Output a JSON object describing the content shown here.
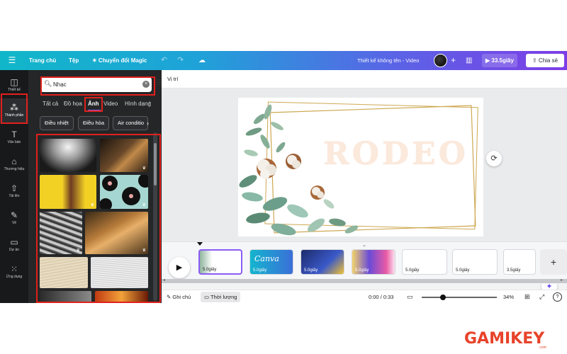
{
  "topbar": {
    "menu_icon": "hamburger-icon",
    "home": "Trang chủ",
    "file": "Tệp",
    "magic": "✶ Chuyển đổi Magic",
    "title": "Thiết kế không tên - Video",
    "plus": "+",
    "play_label": "▶ 33.5giây",
    "share_label": "Chia sẻ"
  },
  "rail": {
    "items": [
      {
        "label": "Thiết kế",
        "icon": "layout-icon"
      },
      {
        "label": "Thành phần",
        "icon": "shapes-icon"
      },
      {
        "label": "Văn bản",
        "icon": "text-icon"
      },
      {
        "label": "Thương hiệu",
        "icon": "brand-icon"
      },
      {
        "label": "Tải lên",
        "icon": "upload-icon"
      },
      {
        "label": "Vẽ",
        "icon": "draw-icon"
      },
      {
        "label": "Dự án",
        "icon": "folder-icon"
      },
      {
        "label": "Ứng dụng",
        "icon": "apps-icon"
      }
    ]
  },
  "panel": {
    "search_value": "Nhạc",
    "tabs": [
      "Tất cả",
      "Đồ họa",
      "Ảnh",
      "Video",
      "Hình dạng"
    ],
    "active_tab": "Ảnh",
    "chips": [
      "Điều nhiệt",
      "Điều hòa",
      "Air conditio"
    ]
  },
  "canvas": {
    "position_label": "Vị trí",
    "slide_text": "RODEO"
  },
  "timeline": {
    "pages": [
      {
        "duration": "5.0giây"
      },
      {
        "duration": "5.0giây"
      },
      {
        "duration": "5.0giây"
      },
      {
        "duration": "5.0giây"
      },
      {
        "duration": "5.0giây"
      },
      {
        "duration": "5.0giây"
      },
      {
        "duration": "3.5giây"
      }
    ],
    "thumb2_text": "Canva",
    "add_label": "+"
  },
  "bottombar": {
    "notes": "Ghi chú",
    "duration": "Thời lượng",
    "time": "0:00 / 0:33",
    "zoom": "34%",
    "zoom_fraction": 0.28,
    "help": "?"
  },
  "watermark": {
    "text": "GAMIKEY",
    "sub": ".com"
  },
  "colors": {
    "accent": "#8b5cf6",
    "highlight": "#e0211d",
    "panel_bg": "#252627"
  }
}
